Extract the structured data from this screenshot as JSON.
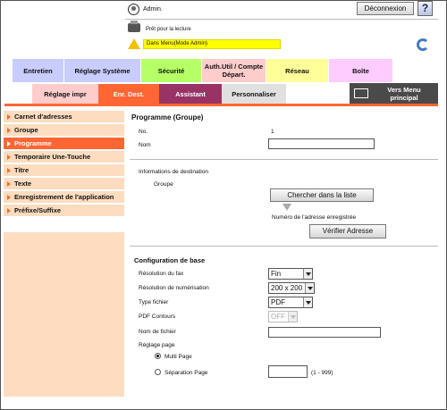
{
  "header": {
    "user": "Admin.",
    "logout": "Déconnexion",
    "help": "?",
    "status": "Prêt pour la lecture",
    "mode": "Dans Menu(Mode Admin)"
  },
  "tabs_row1": [
    "Entretien",
    "Réglage Système",
    "Sécurité",
    "Auth.Util / Compte Départ.",
    "Réseau",
    "Boîte"
  ],
  "tabs_row2": [
    "Réglage impr",
    "Enr. Dest.",
    "Assistant",
    "Personnaliser"
  ],
  "menu_button": "Vers Menu principal",
  "sidebar": {
    "items": [
      {
        "label": "Carnet d'adresses"
      },
      {
        "label": "Groupe"
      },
      {
        "label": "Programme"
      },
      {
        "label": "Temporaire Une-Touche"
      },
      {
        "label": "Titre"
      },
      {
        "label": "Texte"
      },
      {
        "label": "Enregistrement de l'application"
      },
      {
        "label": "Préfixe/Suffixe"
      }
    ]
  },
  "main": {
    "title": "Programme (Groupe)",
    "no_label": "No.",
    "no_value": "1",
    "name_label": "Nom",
    "name_value": "",
    "dest_info": "Informations de destination",
    "group_label": "Groupe",
    "search_list": "Chercher dans la liste",
    "registered_no": "Numéro de l'adresse enregistrée",
    "check_address": "Vérifier Adresse",
    "config_title": "Configuration de base",
    "fax_res_label": "Résolution du fax",
    "fax_res_value": "Fin",
    "scan_res_label": "Résolution de numérisation",
    "scan_res_value": "200 x 200",
    "file_type_label": "Type fichier",
    "file_type_value": "PDF",
    "pdf_outline_label": "PDF Contours",
    "pdf_outline_value": "OFF",
    "file_name_label": "Nom de fichier",
    "file_name_value": "",
    "page_setting_label": "Réglage page",
    "multi_page": "Multi Page",
    "page_separation": "Séparation Page",
    "page_range": "(1 - 999)"
  },
  "colors": {
    "accent": "#ff6633",
    "sidebar_bg": "#fddcbf",
    "tab_entretien": "#c8ccff",
    "tab_reglage": "#c8ccff",
    "tab_securite": "#b6ff66",
    "tab_auth": "#ffcccc",
    "tab_reseau": "#ffff99",
    "tab_boite": "#ffccff",
    "tab_reglage_impr": "#ffcccc",
    "tab_assistant": "#993366",
    "tab_personnaliser": "#e0e0e0",
    "menu_button": "#4a4a4a",
    "mode_bar": "#ffff00"
  },
  "icons": [
    "user-icon",
    "printer-icon",
    "warning-icon",
    "refresh-icon",
    "menu-icon",
    "help-icon"
  ]
}
